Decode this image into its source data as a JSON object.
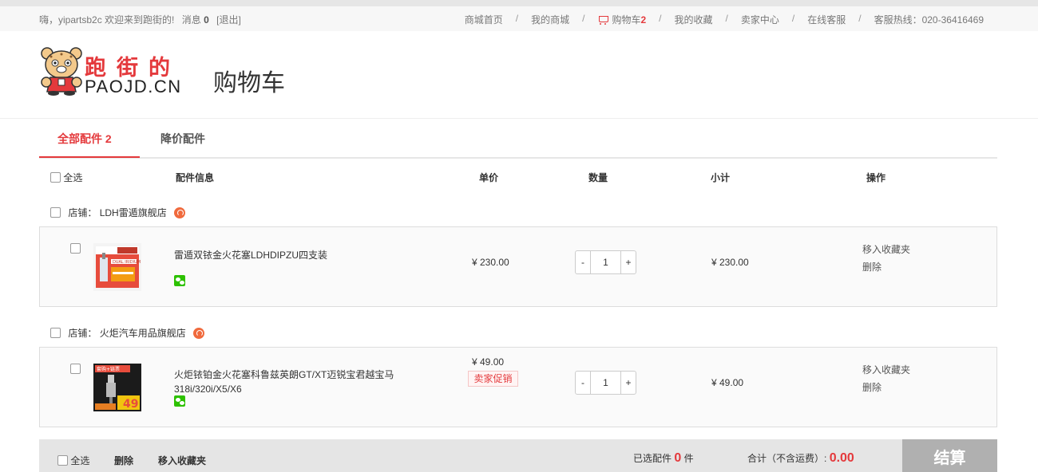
{
  "topbar": {
    "greeting": "嗨，yipartsb2c  欢迎来到跑街的!",
    "messages_label": "消息",
    "messages_count": "0",
    "logout": "[退出]",
    "nav": {
      "home": "商城首页",
      "my_mall": "我的商城",
      "cart_label": "购物车",
      "cart_count": "2",
      "favorites": "我的收藏",
      "seller_center": "卖家中心",
      "online_service": "在线客服",
      "hotline": "客服热线：020-36416469"
    },
    "separator": "/"
  },
  "header": {
    "logo_cn": "跑街的",
    "logo_en": "PAOJD.CN",
    "title": "购物车"
  },
  "tabs": [
    {
      "label": "全部配件",
      "count": "2"
    },
    {
      "label": "降价配件"
    }
  ],
  "table_header": {
    "select_all": "全选",
    "info": "配件信息",
    "unit_price": "单价",
    "quantity": "数量",
    "subtotal": "小计",
    "actions": "操作"
  },
  "shops": [
    {
      "prefix": "店铺：",
      "name": "LDH雷遁旗舰店",
      "item": {
        "name": "雷遁双铱金火花塞LDHDIPZU四支装",
        "price": "¥ 230.00",
        "promo": "",
        "qty": "1",
        "subtotal": "¥ 230.00",
        "thumb_text": "DUAL IRIDIUM"
      }
    },
    {
      "prefix": "店铺：",
      "name": "火炬汽车用品旗舰店",
      "item": {
        "name": "火炬铱铂金火花塞科鲁兹英朗GT/XT迈锐宝君越宝马318i/320i/X5/X6",
        "price": "¥ 49.00",
        "promo": "卖家促销",
        "qty": "1",
        "subtotal": "¥ 49.00",
        "thumb_badge": "套购+链票",
        "thumb_price": "49"
      }
    }
  ],
  "item_actions": {
    "favorite": "移入收藏夹",
    "delete": "删除"
  },
  "qty_controls": {
    "minus": "-",
    "plus": "+"
  },
  "footer": {
    "select_all": "全选",
    "delete": "删除",
    "move_to_favorites": "移入收藏夹",
    "selected_prefix": "已选配件",
    "selected_count": "0",
    "selected_suffix": "件",
    "total_label": "合计（不含运费）:",
    "total_value": "0.00",
    "checkout": "结算"
  },
  "colors": {
    "accent": "#e4393c",
    "checkout_bg": "#b0b0b0",
    "footer_bg": "#e5e5e5"
  }
}
